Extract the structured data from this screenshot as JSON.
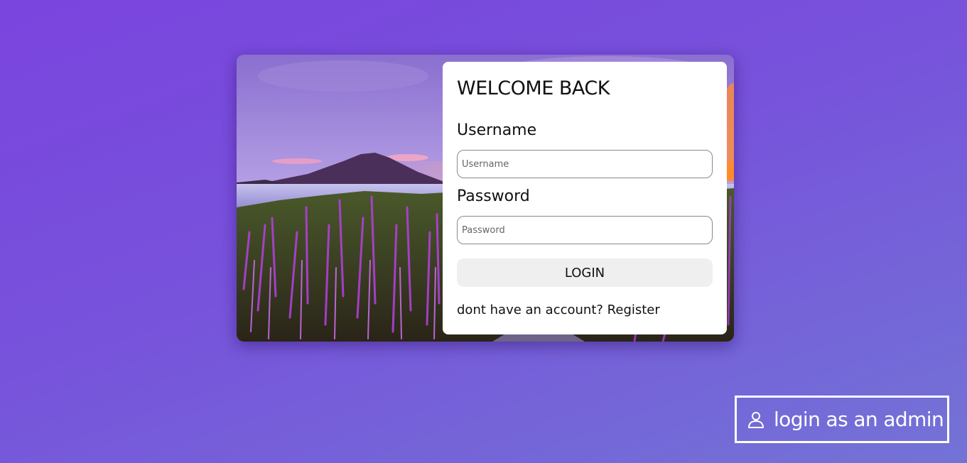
{
  "colors": {
    "background_start": "#7a44de",
    "background_end": "#7373d6",
    "panel": "#ffffff",
    "login_button": "#efefef"
  },
  "login_card": {
    "image_description": "purple flower field with volcano over lake at sunset",
    "title": "WELCOME BACK",
    "username": {
      "label": "Username",
      "placeholder": "Username",
      "value": ""
    },
    "password": {
      "label": "Password",
      "placeholder": "Password",
      "value": ""
    },
    "login_button": "LOGIN",
    "register_prompt": "dont have an account?",
    "register_link": "Register"
  },
  "admin": {
    "icon": "user-icon",
    "label": "login as an admin"
  }
}
